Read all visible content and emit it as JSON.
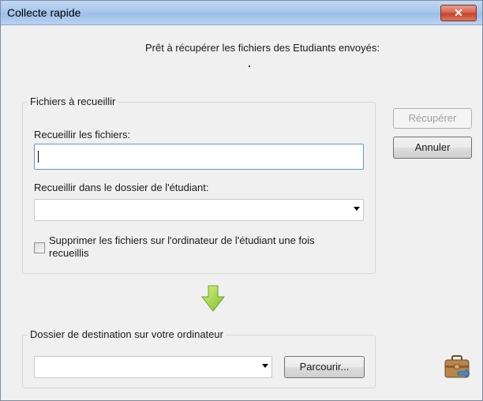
{
  "window": {
    "title": "Collecte rapide",
    "close_glyph": "✕"
  },
  "prompt": "Prêt à récupérer les fichiers des Etudiants envoyés:",
  "files_group": {
    "legend": "Fichiers à recueillir",
    "collect_files_label": "Recueillir les fichiers:",
    "collect_files_value": "",
    "student_folder_label": "Recueillir dans le dossier de l'étudiant:",
    "student_folder_value": "",
    "delete_checkbox_label": "Supprimer les fichiers sur l'ordinateur de l'étudiant une fois recueillis",
    "delete_checked": false
  },
  "buttons": {
    "retrieve": "Récupérer",
    "cancel": "Annuler",
    "browse": "Parcourir..."
  },
  "destination_group": {
    "legend": "Dossier de destination sur votre ordinateur",
    "value": ""
  },
  "icons": {
    "arrow": "down-arrow-icon",
    "briefcase": "briefcase-transfer-icon"
  },
  "colors": {
    "arrow_green": "#8cc63f",
    "title_bar": "#a8c7ec",
    "close_red": "#c7432a"
  }
}
